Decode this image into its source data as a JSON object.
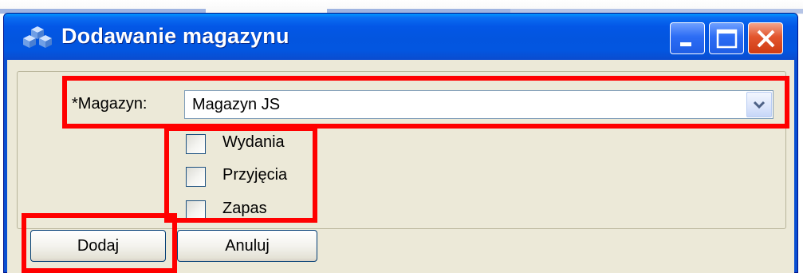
{
  "window": {
    "title": "Dodawanie magazynu",
    "title_icon": "cubes-icon",
    "controls": [
      {
        "name": "minimize",
        "icon": "minimize-icon"
      },
      {
        "name": "maximize",
        "icon": "maximize-icon"
      },
      {
        "name": "close",
        "icon": "close-icon"
      }
    ]
  },
  "form": {
    "magazyn_label": "*Magazyn:",
    "magazyn_value": "Magazyn JS",
    "dropdown_icon": "chevron-down-icon",
    "checkboxes": [
      {
        "label": "Wydania",
        "checked": false
      },
      {
        "label": "Przyjęcia",
        "checked": false
      },
      {
        "label": "Zapas",
        "checked": false
      }
    ]
  },
  "buttons": {
    "add_label": "Dodaj",
    "cancel_label": "Anuluj"
  },
  "colors": {
    "titlebar": "#0355df",
    "client_background": "#ece9d8",
    "highlight": "#ff0000",
    "close_button": "#e2552d"
  }
}
